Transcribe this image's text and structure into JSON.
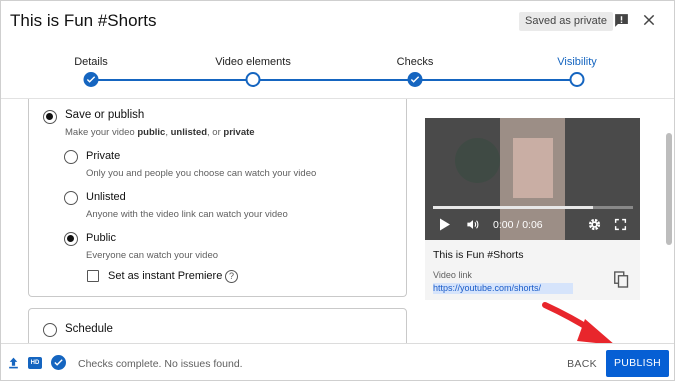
{
  "header": {
    "title": "This is Fun #Shorts",
    "saved_badge": "Saved as private",
    "feedback_icon": "report-feedback-icon",
    "close_icon": "close-icon"
  },
  "stepper": {
    "steps": [
      {
        "label": "Details",
        "state": "done"
      },
      {
        "label": "Video elements",
        "state": "open"
      },
      {
        "label": "Checks",
        "state": "done"
      },
      {
        "label": "Visibility",
        "state": "active"
      }
    ]
  },
  "visibility": {
    "save_or_publish": {
      "label": "Save or publish",
      "sub_prefix": "Make your video ",
      "sub_public": "public",
      "sub_sep1": ", ",
      "sub_unlisted": "unlisted",
      "sub_sep2": ", or ",
      "sub_private": "private",
      "selected": true
    },
    "options": [
      {
        "label": "Private",
        "description": "Only you and people you choose can watch your video",
        "selected": false
      },
      {
        "label": "Unlisted",
        "description": "Anyone with the video link can watch your video",
        "selected": false
      },
      {
        "label": "Public",
        "description": "Everyone can watch your video",
        "selected": true
      }
    ],
    "premiere": {
      "label": "Set as instant Premiere",
      "checked": false,
      "help_icon": "?"
    },
    "schedule": {
      "label": "Schedule",
      "selected": false
    }
  },
  "video": {
    "time": "0:00 / 0:06",
    "progress": 0.8,
    "title": "This is Fun #Shorts",
    "link_label": "Video link",
    "link": "https://youtube.com/shorts/"
  },
  "footer": {
    "status": "Checks complete. No issues found.",
    "hd_badge": "HD",
    "back_label": "BACK",
    "publish_label": "PUBLISH"
  },
  "colors": {
    "accent": "#1565c0",
    "publish": "#065fd4",
    "annotation_arrow": "#e8262c"
  }
}
